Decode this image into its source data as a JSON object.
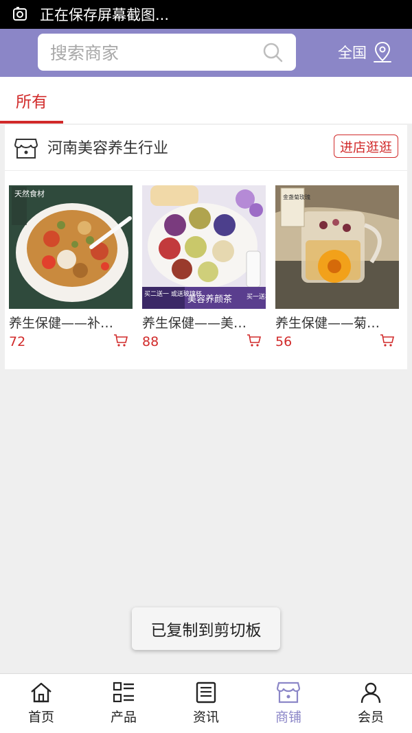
{
  "status_bar": {
    "text": "正在保存屏幕截图..."
  },
  "search": {
    "placeholder": "搜索商家"
  },
  "region": {
    "label": "全国"
  },
  "tabs": [
    {
      "label": "所有",
      "active": true
    }
  ],
  "store": {
    "name": "河南美容养生行业",
    "visit_label": "进店逛逛",
    "products": [
      {
        "name": "养生保健——补…",
        "price": "72"
      },
      {
        "name": "养生保健——美…",
        "price": "88"
      },
      {
        "name": "养生保健——菊…",
        "price": "56"
      }
    ],
    "image_texts": {
      "p1_stamp": "天然食材",
      "p2_left_banner": "买二送一 或送玻璃杯",
      "p2_center_banner": "美容养颜茶",
      "p2_right_banner": "买一送杯",
      "p3_label": "金盏菊玫瑰"
    }
  },
  "toast": {
    "text": "已复制到剪切板"
  },
  "bottom_nav": [
    {
      "label": "首页",
      "icon": "home-icon",
      "active": false
    },
    {
      "label": "产品",
      "icon": "list-icon",
      "active": false
    },
    {
      "label": "资讯",
      "icon": "news-icon",
      "active": false
    },
    {
      "label": "商铺",
      "icon": "shop-icon",
      "active": true
    },
    {
      "label": "会员",
      "icon": "user-icon",
      "active": false
    }
  ],
  "colors": {
    "accent": "#8b86c7",
    "price": "#d12a2a",
    "status_bar": "#000000"
  }
}
